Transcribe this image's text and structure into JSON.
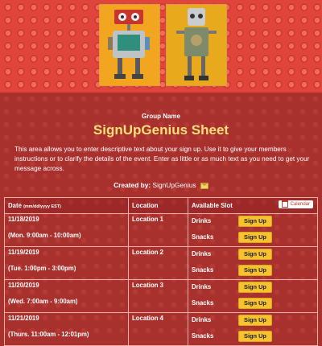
{
  "header": {
    "group_label": "Group Name",
    "title": "SignUpGenius Sheet"
  },
  "description": "This area allows you to enter descriptive text about your sign up. Use it to give your members instructions or to clarify the details of the event. Enter as little or as much text as you need to get your message across.",
  "created_by": {
    "label": "Created by:",
    "name": "SignUpGenius"
  },
  "table": {
    "headers": {
      "date": "Date",
      "date_format": "(mm/dd/yyyy EST)",
      "location": "Location",
      "slot": "Available Slot",
      "calendar": "Calendar"
    },
    "rows": [
      {
        "date": "11/18/2019",
        "time": "(Mon. 9:00am - 10:00am)",
        "location": "Location 1",
        "slots": [
          "Drinks",
          "Snacks"
        ]
      },
      {
        "date": "11/19/2019",
        "time": "(Tue. 1:00pm - 3:00pm)",
        "location": "Location 2",
        "slots": [
          "Drinks",
          "Snacks"
        ]
      },
      {
        "date": "11/20/2019",
        "time": "(Wed. 7:00am - 9:00am)",
        "location": "Location 3",
        "slots": [
          "Drinks",
          "Snacks"
        ]
      },
      {
        "date": "11/21/2019",
        "time": "(Thurs. 11:00am - 12:01pm)",
        "location": "Location 4",
        "slots": [
          "Drinks",
          "Snacks"
        ]
      }
    ],
    "signup_label": "Sign Up"
  },
  "colors": {
    "background": "#a8312e",
    "title": "#f6e07a",
    "button": "#f6c230"
  }
}
